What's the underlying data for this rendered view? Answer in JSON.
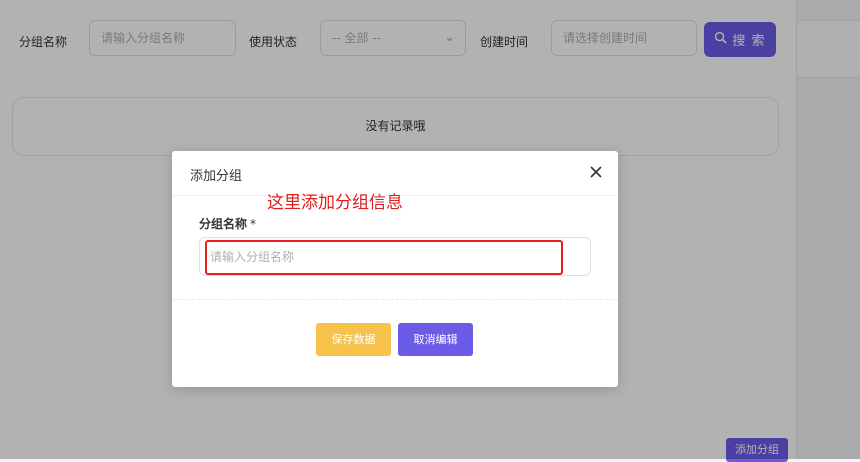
{
  "filters": {
    "group_name_label": "分组名称",
    "group_name_placeholder": "请输入分组名称",
    "status_label": "使用状态",
    "status_selected": "-- 全部 --",
    "created_label": "创建时间",
    "created_placeholder": "请选择创建时间",
    "search_button": "搜 索"
  },
  "table": {
    "empty_text": "没有记录哦"
  },
  "footer": {
    "add_group_button": "添加分组"
  },
  "modal": {
    "title": "添加分组",
    "annotation": "这里添加分组信息",
    "field_label": "分组名称",
    "required_mark": "*",
    "field_placeholder": "请输入分组名称",
    "field_value": "",
    "save_button": "保存数据",
    "cancel_button": "取消编辑"
  },
  "colors": {
    "primary": "#6b5ce7",
    "save": "#f7c24a",
    "annotation": "#e02020"
  },
  "icons": {
    "search": "search-icon",
    "close": "close-icon",
    "chevron": "chevron-down-icon"
  }
}
